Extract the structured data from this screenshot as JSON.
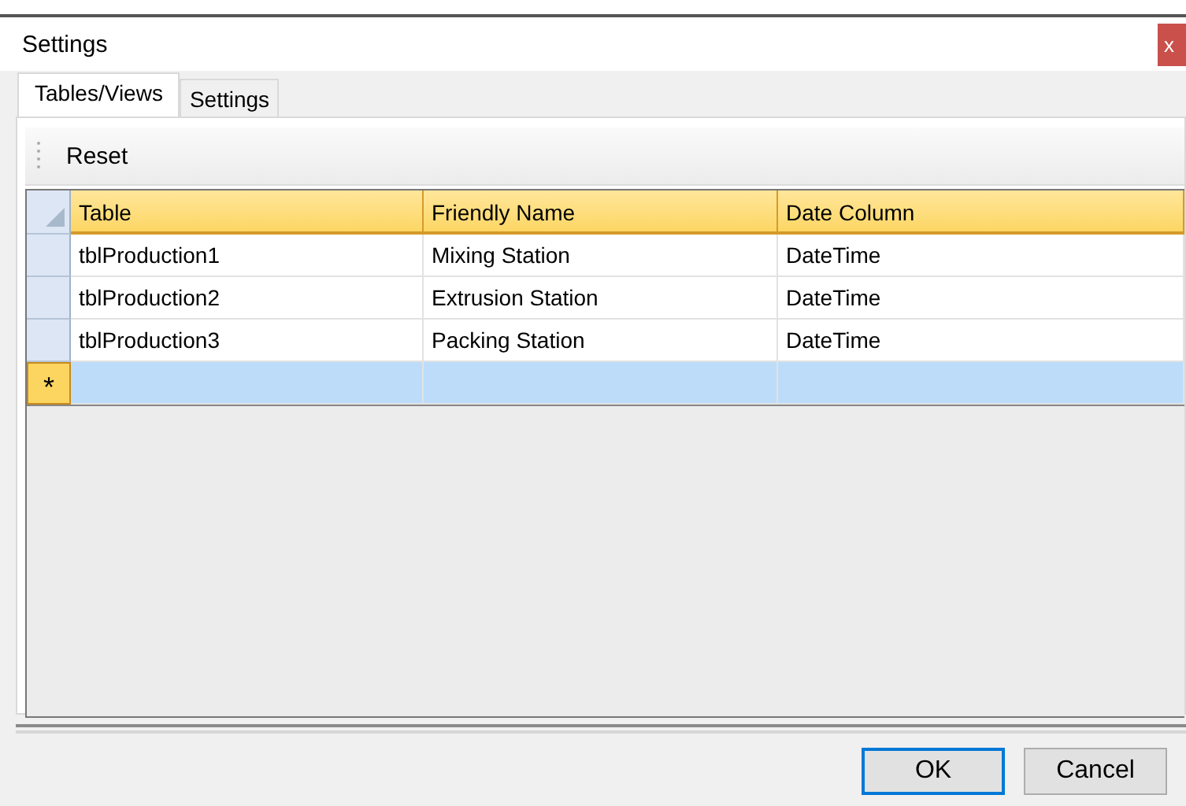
{
  "window": {
    "title": "Settings",
    "close": "x"
  },
  "tabs": [
    {
      "label": "Tables/Views",
      "selected": true
    },
    {
      "label": "Settings",
      "selected": false
    }
  ],
  "toolbar": {
    "items": [
      "Reset"
    ]
  },
  "table": {
    "columns": [
      "Table",
      "Friendly Name",
      "Date Column"
    ],
    "rows": [
      {
        "cells": [
          "tblProduction1",
          "Mixing Station",
          "DateTime"
        ],
        "selected": false
      },
      {
        "cells": [
          "tblProduction2",
          "Extrusion Station",
          "DateTime"
        ],
        "selected": false
      },
      {
        "cells": [
          "tblProduction3",
          "Packing Station",
          "DateTime"
        ],
        "selected": false
      }
    ],
    "new_row": {
      "marker": "*",
      "selected": true
    }
  },
  "buttons": [
    {
      "label": "OK",
      "default": true
    },
    {
      "label": "Cancel",
      "default": false
    }
  ]
}
